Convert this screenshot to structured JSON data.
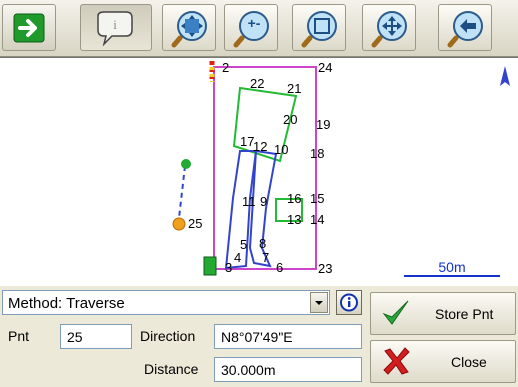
{
  "toolbar": {
    "buttons": [
      {
        "name": "next-arrow-icon"
      },
      {
        "name": "speech-bubble-icon"
      },
      {
        "name": "zoom-all-icon"
      },
      {
        "name": "zoom-out-icon"
      },
      {
        "name": "zoom-window-icon"
      },
      {
        "name": "pan-icon"
      },
      {
        "name": "back-arrow-icon"
      }
    ]
  },
  "map": {
    "point_labels": [
      "2",
      "24",
      "22",
      "21",
      "20",
      "19",
      "17",
      "12",
      "10",
      "18",
      "16",
      "15",
      "11",
      "9",
      "13",
      "14",
      "25",
      "5",
      "8",
      "4",
      "7",
      "3",
      "6",
      "23"
    ],
    "scale_label": "50m",
    "colors": {
      "boundary": "#cc44cc",
      "green_lot": "#22bb33",
      "blue_lot": "#3344cc",
      "point_marker": "#22aa33",
      "current_point": "#f0a020"
    }
  },
  "form": {
    "method_label": "Method: Traverse",
    "pnt_label": "Pnt",
    "pnt_value": "25",
    "direction_label": "Direction",
    "direction_value": "N8°07'49\"E",
    "distance_label": "Distance",
    "distance_value": "30.000m"
  },
  "actions": {
    "store_label": "Store Pnt",
    "close_label": "Close"
  }
}
